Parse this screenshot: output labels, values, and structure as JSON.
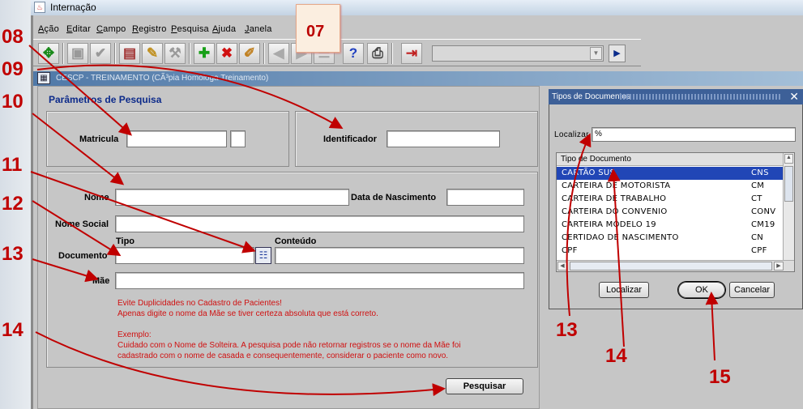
{
  "window": {
    "title": "Internação"
  },
  "menu": [
    "Ação",
    "Editar",
    "Campo",
    "Registro",
    "Pesquisa",
    "Ajuda",
    "Janela"
  ],
  "instance_bar": "CESCP - TREINAMENTO (CÃ³pia Homologa Treinamento)",
  "form": {
    "title": "Parâmetros de Pesquisa",
    "matricula_label": "Matricula",
    "identificador_label": "Identificador",
    "nome_label": "Nome",
    "data_nasc_label": "Data de Nascimento",
    "nome_social_label": "Nome Social",
    "tipo_label": "Tipo",
    "conteudo_label": "Conteúdo",
    "documento_label": "Documento",
    "mae_label": "Mãe",
    "warning_lines": [
      "Evite Duplicidades no Cadastro de Pacientes!",
      "Apenas digite o nome da Mãe se tiver certeza absoluta que está correto.",
      "",
      "Exemplo:",
      "Cuidado com o Nome de Solteira. A pesquisa pode não retornar registros se o nome da Mãe foi",
      "cadastrado com o nome de casada e consequentemente, considerar o paciente como novo."
    ],
    "pesquisar_label": "Pesquisar"
  },
  "dialog": {
    "title": "Tipos de Documentos",
    "localizar_label": "Localizar",
    "localizar_value": "%",
    "column_header": "Tipo de Documento",
    "rows": [
      {
        "name": "CARTÃO SUS",
        "code": "CNS",
        "selected": true
      },
      {
        "name": "CARTEIRA DE MOTORISTA",
        "code": "CM"
      },
      {
        "name": "CARTEIRA DE TRABALHO",
        "code": "CT"
      },
      {
        "name": "CARTEIRA DO CONVENIO",
        "code": "CONV"
      },
      {
        "name": "CARTEIRA MODELO 19",
        "code": "CM19"
      },
      {
        "name": "CERTIDAO DE NASCIMENTO",
        "code": "CN"
      },
      {
        "name": "CPF",
        "code": "CPF"
      }
    ],
    "localizar_button": "Localizar",
    "ok_button": "OK",
    "cancel_button": "Cancelar"
  },
  "callouts": [
    "07",
    "08",
    "09",
    "10",
    "11",
    "12",
    "13",
    "14",
    "13",
    "14",
    "15"
  ],
  "colors": {
    "callout_red": "#c00000",
    "selection_blue": "#2146b6",
    "form_title_blue": "#0c2a8a"
  }
}
